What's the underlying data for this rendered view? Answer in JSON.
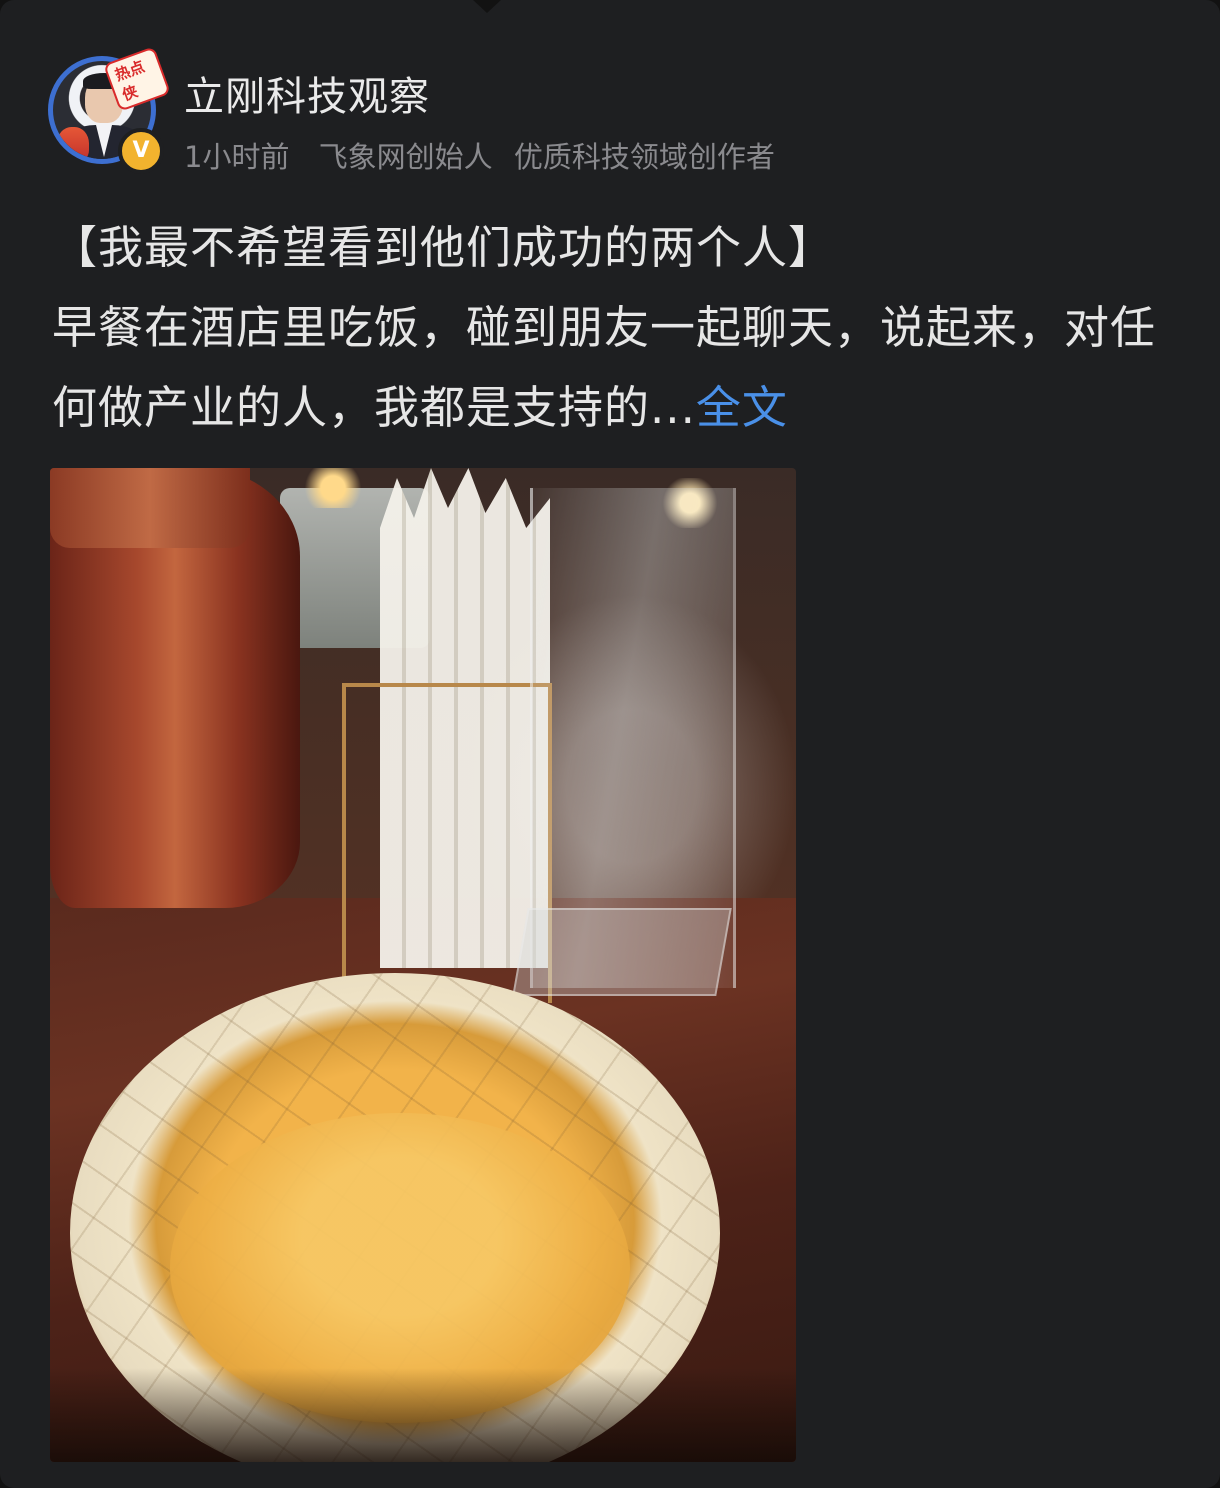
{
  "author": {
    "name": "立刚科技观察",
    "avatar_badge": "热点侠",
    "verified_symbol": "V",
    "time": "1小时前",
    "tags": [
      "飞象网创始人",
      "优质科技领域创作者"
    ]
  },
  "post": {
    "title": "【我最不希望看到他们成功的两个人】",
    "body": "早餐在酒店里吃饭，碰到朋友一起聊天，说起来，对任何做产业的人，我都是支持的...",
    "more_label": "全文"
  },
  "colors": {
    "background": "#1e1f21",
    "link": "#4a90e8",
    "meta_text": "#8a8a8e",
    "verified_badge": "#f2b32e"
  },
  "icons": {
    "avatar": "author-avatar",
    "verified": "verified-v-icon"
  }
}
